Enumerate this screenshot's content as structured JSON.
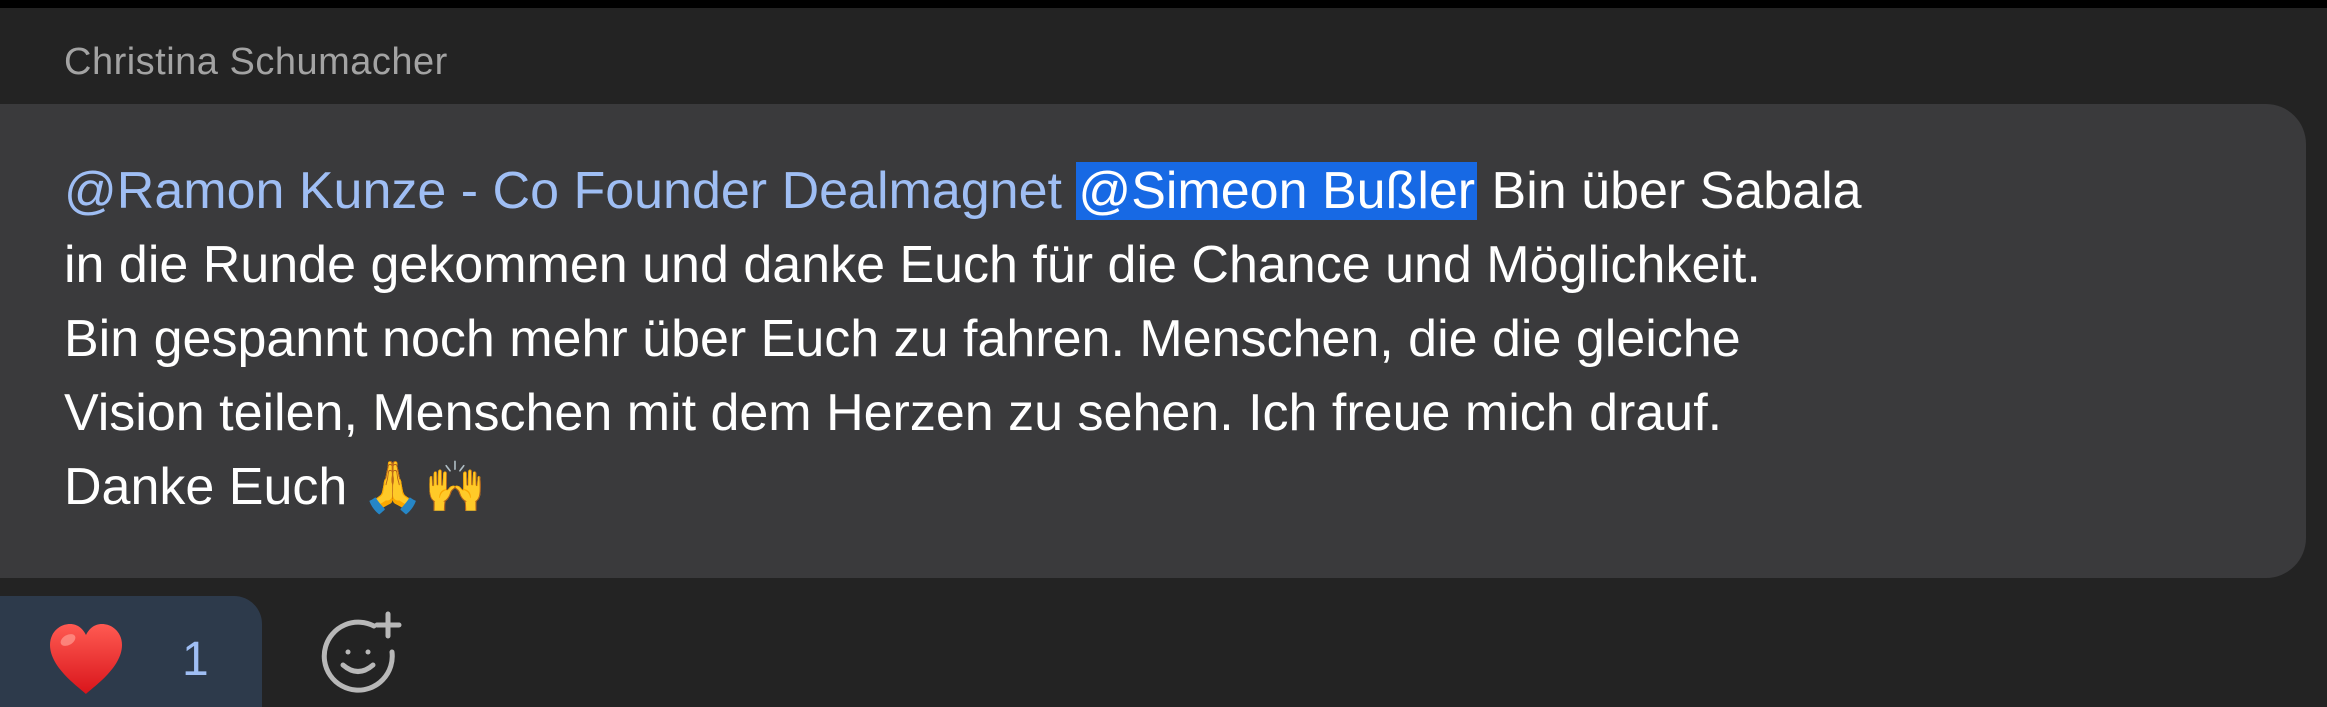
{
  "sender": {
    "name": "Christina Schumacher"
  },
  "message": {
    "mention_1": "@Ramon Kunze - Co Founder Dealmagnet",
    "mention_2": "@Simeon Bußler",
    "line_1_rest": " Bin über Sabala",
    "line_2": "in die Runde gekommen und danke Euch für die Chance und Möglichkeit.",
    "line_3": "Bin gespannt noch mehr über Euch zu fahren. Menschen, die die gleiche",
    "line_4": "Vision teilen, Menschen mit dem Herzen zu sehen. Ich freue mich drauf.",
    "line_5": "Danke Euch ",
    "emoji_1": "🙏",
    "emoji_2": "🙌"
  },
  "reactions": [
    {
      "emoji": "❤️",
      "icon": "heart-icon",
      "count": "1"
    }
  ],
  "add_reaction": {
    "icon": "smiley-plus-icon"
  },
  "colors": {
    "background": "#232323",
    "bubble": "#3a3a3c",
    "mention": "#9fbef4",
    "selection": "#1769e4",
    "reaction_pill": "#2d3a4b",
    "sender_name": "#a3a3a3"
  }
}
